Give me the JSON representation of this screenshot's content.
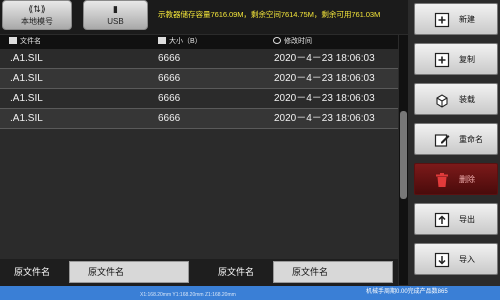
{
  "source": {
    "local_label": "本地模号",
    "usb_label": "USB",
    "storage_info": "示教器储存容量7616.09M，剩余空间7614.75M，剩余可用761.03M"
  },
  "table": {
    "columns": [
      "文件名",
      "大小（B）",
      "修改时间"
    ],
    "rows": [
      {
        "name": ".A1.SIL",
        "size": "6666",
        "time": "2020－4－23 18:06:03"
      },
      {
        "name": ".A1.SIL",
        "size": "6666",
        "time": "2020－4－23 18:06:03"
      },
      {
        "name": ".A1.SIL",
        "size": "6666",
        "time": "2020－4－23 18:06:03"
      },
      {
        "name": ".A1.SIL",
        "size": "6666",
        "time": "2020－4－23 18:06:03"
      }
    ]
  },
  "bottom": {
    "left_label": "原文件名",
    "left_value": "原文件名",
    "right_label": "原文件名",
    "right_value": "原文件名"
  },
  "sidebar": {
    "buttons": [
      {
        "label": "新建",
        "icon": "new-file-icon"
      },
      {
        "label": "复制",
        "icon": "copy-icon"
      },
      {
        "label": "装载",
        "icon": "load-icon"
      },
      {
        "label": "重命名",
        "icon": "rename-icon"
      },
      {
        "label": "删除",
        "icon": "delete-icon"
      },
      {
        "label": "导出",
        "icon": "export-icon"
      },
      {
        "label": "导入",
        "icon": "import-icon"
      }
    ]
  },
  "status": {
    "text": "机械手周期0.00完成产品数865",
    "coords": "X1:168.20mm    Y1:168.20mm    Z1:168.20mm"
  },
  "colors": {
    "storage_text": "#f2e43a",
    "status_bar": "#3a7fd6",
    "delete_button": "#6a1414",
    "delete_icon": "#e23a3a"
  }
}
